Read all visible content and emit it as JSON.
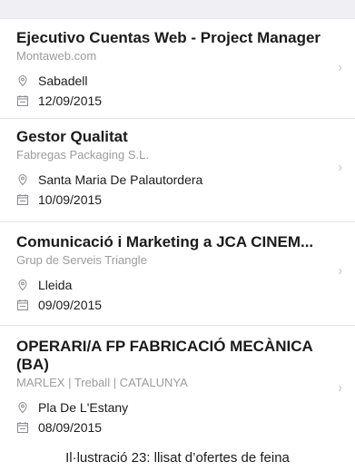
{
  "jobs": [
    {
      "title": "Ejecutivo Cuentas Web - Project Manager",
      "company": "Montaweb.com",
      "location": "Sabadell",
      "date": "12/09/2015"
    },
    {
      "title": "Gestor Qualitat",
      "company": "Fabregas Packaging S.L.",
      "location": "Santa Maria De Palautordera",
      "date": "10/09/2015"
    },
    {
      "title": "Comunicació i Marketing a  JCA CINEM...",
      "company": "Grup de Serveis Triangle",
      "location": "Lleida",
      "date": "09/09/2015"
    },
    {
      "title": "OPERARI/A FP FABRICACIÓ MECÀNICA (BA)",
      "company": "MARLEX  | Treball | CATALUNYA",
      "location": "Pla De L'Estany",
      "date": "08/09/2015"
    }
  ],
  "chevron": "›",
  "icons": {
    "location": "location-pin-icon",
    "date": "calendar-icon"
  },
  "caption": "Il·lustració 23: llisat d’ofertes de feina"
}
